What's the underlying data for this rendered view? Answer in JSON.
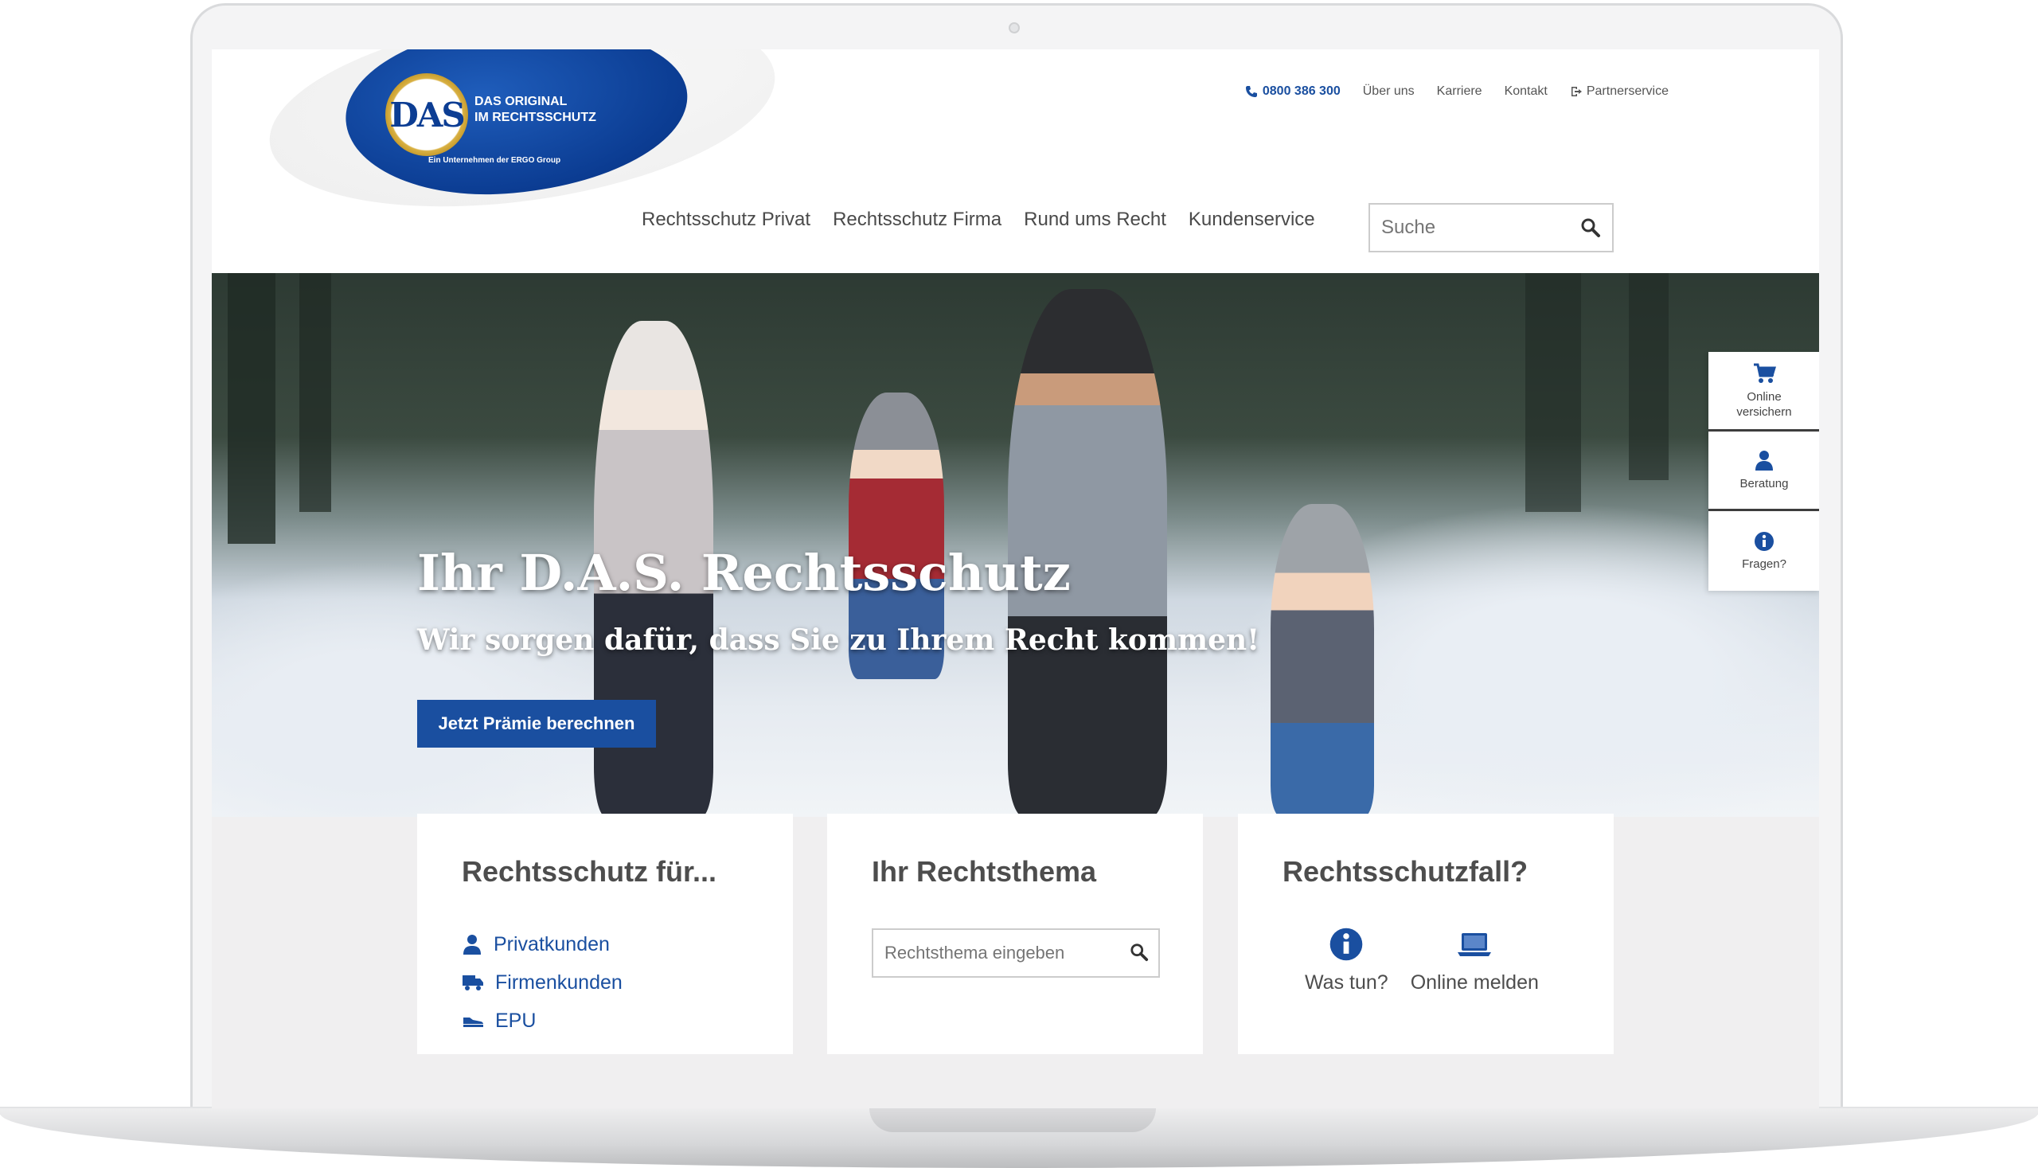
{
  "header": {
    "logo": {
      "mark": "DAS",
      "line1": "DAS ORIGINAL",
      "line2": "IM RECHTSSCHUTZ",
      "sub": "Ein Unternehmen der ERGO Group"
    },
    "top_links": {
      "phone": "0800 386 300",
      "about": "Über uns",
      "careers": "Karriere",
      "contact": "Kontakt",
      "partner": "Partnerservice"
    },
    "nav": {
      "private": "Rechtsschutz Privat",
      "company": "Rechtsschutz Firma",
      "law": "Rund ums Recht",
      "service": "Kundenservice"
    },
    "search": {
      "placeholder": "Suche"
    }
  },
  "hero": {
    "title": "Ihr D.A.S. Rechtsschutz",
    "subtitle": "Wir sorgen dafür, dass Sie zu Ihrem Recht kommen!",
    "cta": "Jetzt Prämie berechnen"
  },
  "side_widget": {
    "online": {
      "line1": "Online",
      "line2": "versichern"
    },
    "advice": "Beratung",
    "questions": "Fragen?"
  },
  "cards": {
    "protection_for": {
      "title": "Rechtsschutz für...",
      "links": [
        "Privatkunden",
        "Firmenkunden",
        "EPU"
      ]
    },
    "topic": {
      "title": "Ihr Rechtsthema",
      "placeholder": "Rechtsthema eingeben"
    },
    "case": {
      "title": "Rechtsschutzfall?",
      "what_to_do": "Was tun?",
      "report_online": "Online melden"
    }
  },
  "colors": {
    "brand_blue": "#1a4fa0",
    "text_gray": "#4d4d4d",
    "panel_gray": "#f0eff0"
  }
}
